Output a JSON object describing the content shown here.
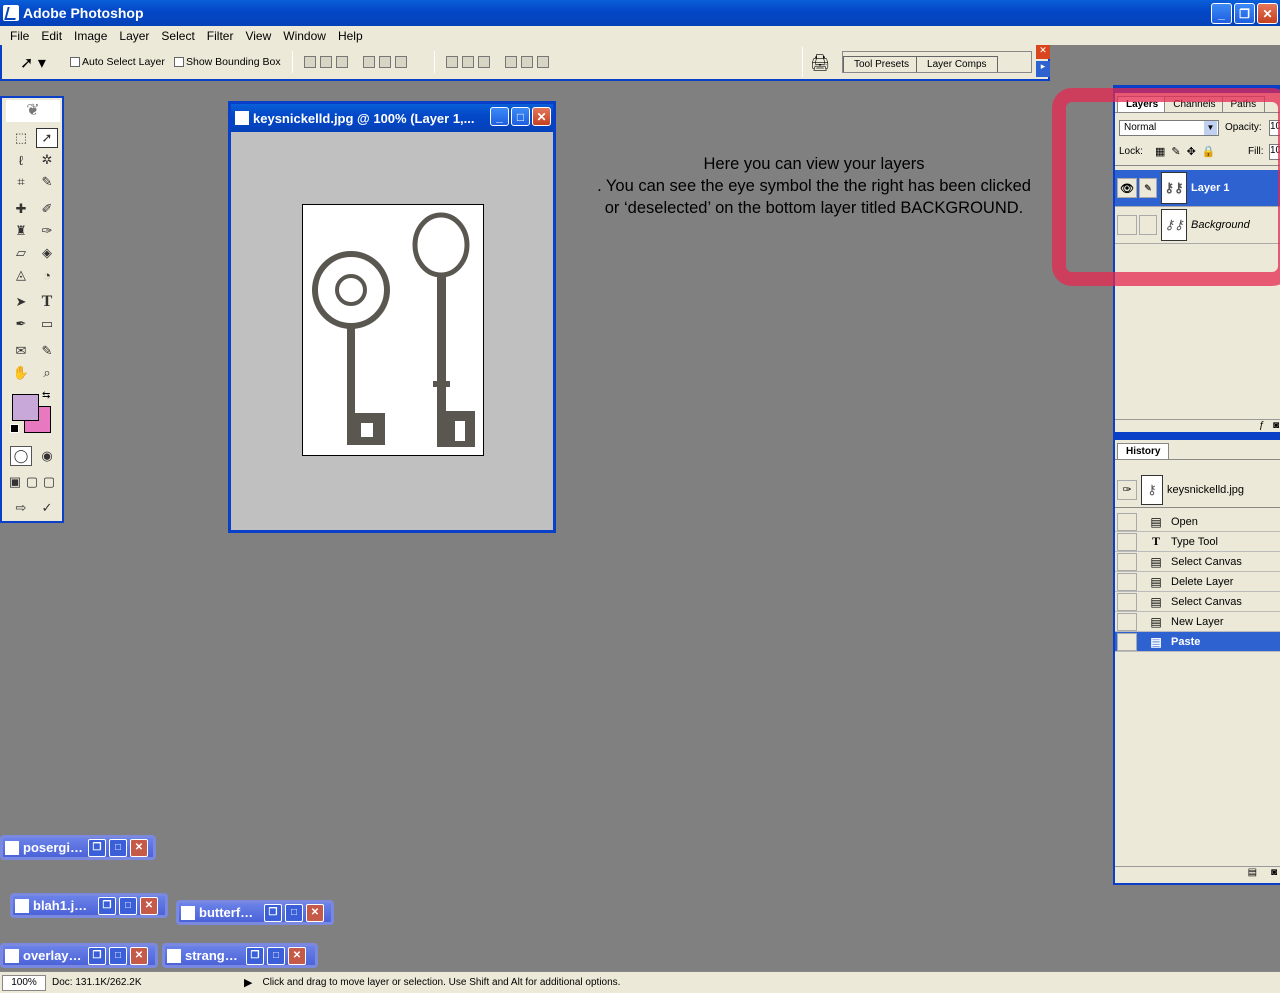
{
  "app": {
    "title": "Adobe Photoshop"
  },
  "menu": [
    "File",
    "Edit",
    "Image",
    "Layer",
    "Select",
    "Filter",
    "View",
    "Window",
    "Help"
  ],
  "options": {
    "auto_select": "Auto Select Layer",
    "show_bbox": "Show Bounding Box",
    "well_tabs": [
      "Tool Presets",
      "Layer Comps"
    ]
  },
  "document": {
    "title": "keysnickelld.jpg @ 100% (Layer 1,..."
  },
  "note": {
    "line1": "Here you can view your layers",
    "line2": ". You can see the eye symbol the the right has been clicked",
    "line3": "or ‘deselected’ on the bottom layer titled BACKGROUND."
  },
  "layers_panel": {
    "tabs": [
      "Layers",
      "Channels",
      "Paths"
    ],
    "blend_mode": "Normal",
    "opacity_label": "Opacity:",
    "opacity_value": "10",
    "lock_label": "Lock:",
    "fill_label": "Fill:",
    "fill_value": "10",
    "layers": [
      {
        "name": "Layer 1"
      },
      {
        "name": "Background"
      }
    ]
  },
  "history_panel": {
    "tab": "History",
    "snapshot": "keysnickelld.jpg",
    "steps": [
      "Open",
      "Type Tool",
      "Select Canvas",
      "Delete Layer",
      "Select Canvas",
      "New Layer",
      "Paste"
    ]
  },
  "minimized_windows": [
    "posergi…",
    "blah1.j…",
    "butterf…",
    "overlay…",
    "strang…"
  ],
  "status": {
    "zoom": "100%",
    "doc": "Doc: 131.1K/262.2K",
    "hint": "Click and drag to move layer or selection.  Use Shift and Alt for additional options."
  },
  "colors": {
    "foreground": "#c8a8d8",
    "background": "#e878c0",
    "accent": "#0a3fc8",
    "highlight_stroke": "#e62850"
  }
}
